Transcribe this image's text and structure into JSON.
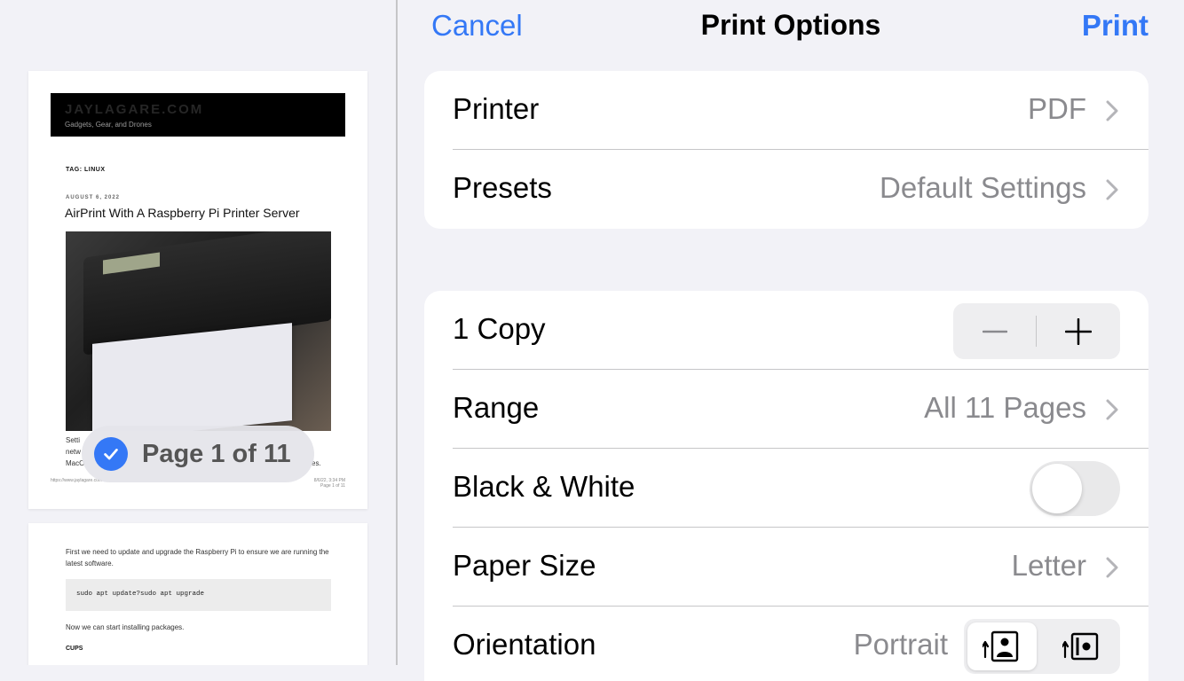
{
  "preview": {
    "page1": {
      "site_title": "JAYLAGARE.COM",
      "site_tagline": "Gadgets, Gear, and Drones",
      "tag_label": "TAG: LINUX",
      "post_date": "AUGUST 6, 2022",
      "post_title": "AirPrint With A Raspberry Pi Printer Server",
      "body_line1": "Setti",
      "body_line2": "netw",
      "body_line3": "MacO",
      "body_tail": "es.",
      "footer_left": "https://www.jaylagare.com",
      "footer_right_date": "8/6/22, 3:34 PM",
      "footer_right_page": "Page 1 of 11"
    },
    "badge": {
      "text": "Page 1 of 11"
    },
    "page2": {
      "para": "First we need to update and upgrade the Raspberry Pi to ensure we are running the latest software.",
      "code": "sudo apt update?sudo apt upgrade",
      "para2": "Now we can start installing packages.",
      "heading": "CUPS"
    }
  },
  "nav": {
    "cancel": "Cancel",
    "title": "Print Options",
    "print": "Print"
  },
  "settings": {
    "printer": {
      "label": "Printer",
      "value": "PDF"
    },
    "presets": {
      "label": "Presets",
      "value": "Default Settings"
    },
    "copies": {
      "label": "1 Copy"
    },
    "range": {
      "label": "Range",
      "value": "All 11 Pages"
    },
    "bw": {
      "label": "Black & White",
      "enabled": false
    },
    "paper": {
      "label": "Paper Size",
      "value": "Letter"
    },
    "orientation": {
      "label": "Orientation",
      "value": "Portrait"
    }
  },
  "icons": {
    "chevron": "chevron-right-icon",
    "check": "checkmark-icon",
    "minus": "minus-icon",
    "plus": "plus-icon",
    "portrait": "portrait-orientation-icon",
    "landscape": "landscape-orientation-icon"
  },
  "colors": {
    "accent": "#3478f6",
    "background": "#f2f2f7",
    "secondary_text": "#8a8a8e",
    "separator": "#c6c6c8"
  }
}
